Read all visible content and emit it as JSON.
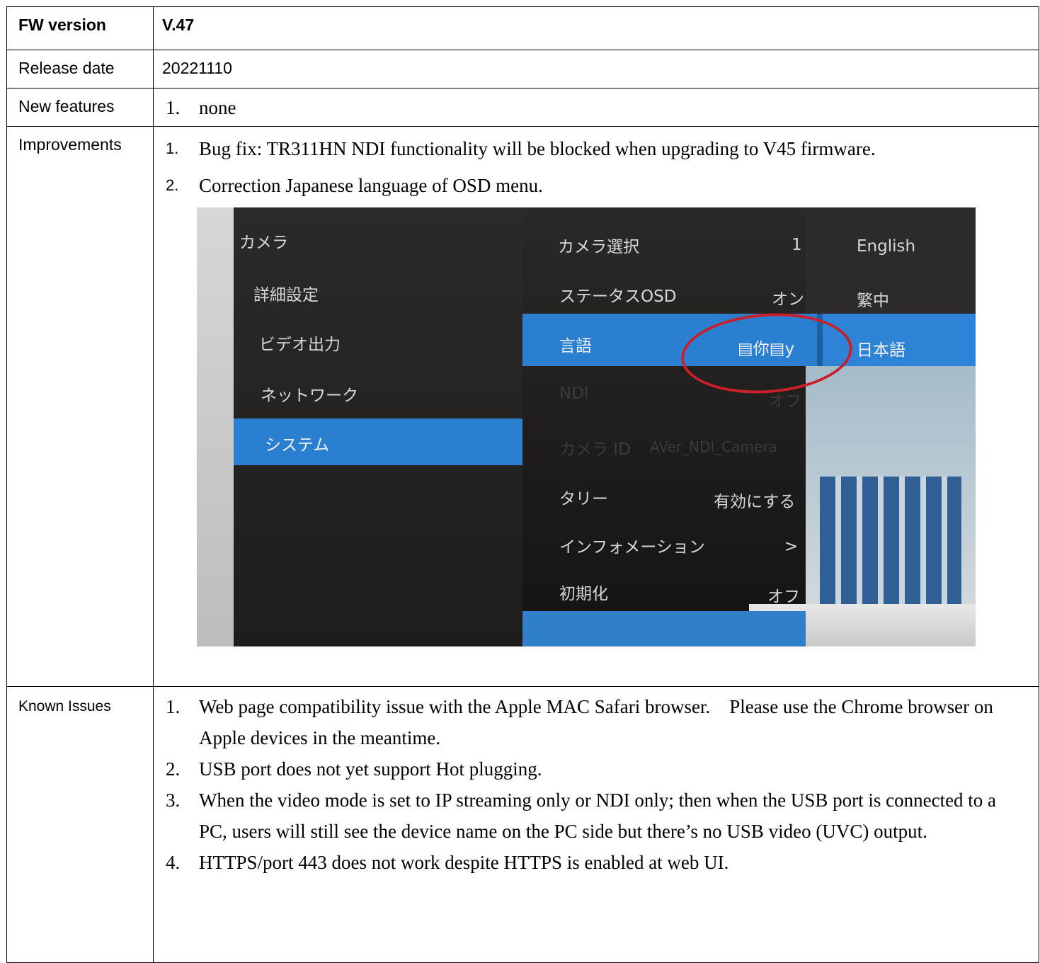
{
  "rows": {
    "fw_label": "FW version",
    "fw_value": "V.47",
    "release_label": "Release date",
    "release_value": "20221110",
    "features_label": "New features",
    "features": [
      {
        "num": "1.",
        "text": "none"
      }
    ],
    "improvements_label": "Improvements",
    "improvements": [
      {
        "num": "1.",
        "text": "Bug fix: TR311HN NDI functionality will be blocked when upgrading to V45 firmware."
      },
      {
        "num": "2.",
        "text": "Correction Japanese language of OSD menu."
      }
    ],
    "known_label": "Known Issues",
    "known": [
      {
        "num": "1.",
        "text": "Web page compatibility issue with the Apple MAC Safari browser.    Please use the Chrome browser on Apple devices in the meantime."
      },
      {
        "num": "2.",
        "text": "USB port does not yet support Hot plugging."
      },
      {
        "num": "3.",
        "text": "When the video mode is set to IP streaming only or NDI only; then when the USB port is connected to a PC, users will still see the device name on the PC side but there’s no USB video (UVC) output."
      },
      {
        "num": "4.",
        "text": "HTTPS/port 443 does not work despite HTTPS is enabled at web UI."
      }
    ]
  },
  "osd": {
    "menu": [
      "カメラ",
      "詳細設定",
      "ビデオ出力",
      "ネットワーク",
      "システム"
    ],
    "settings": [
      {
        "label": "カメラ選択",
        "value": "1"
      },
      {
        "label": "ステータスOSD",
        "value": "オン"
      },
      {
        "label": "言語",
        "value": "▤你▤y"
      },
      {
        "label": "NDI",
        "value": "オフ"
      },
      {
        "label": "カメラ ID",
        "value": "AVer_NDI_Camera"
      },
      {
        "label": "タリー",
        "value": "有効にする"
      },
      {
        "label": "インフォメーション",
        "value": ">"
      },
      {
        "label": "初期化",
        "value": "オフ"
      }
    ],
    "languages": [
      "English",
      "繁中",
      "日本語"
    ]
  }
}
